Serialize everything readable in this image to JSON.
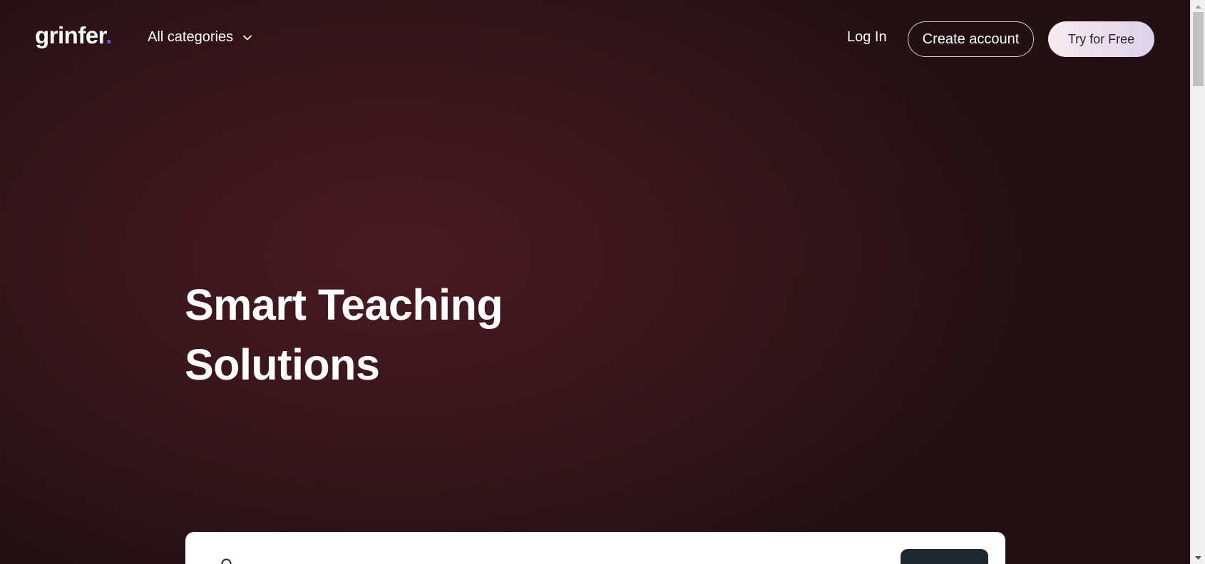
{
  "header": {
    "logo_text": "grinfer",
    "logo_dot": ".",
    "categories_label": "All categories",
    "login_label": "Log In",
    "create_account_label": "Create account",
    "try_free_label": "Try for Free"
  },
  "hero": {
    "title_line1": "Smart Teaching",
    "title_line2": "Solutions"
  },
  "icons": {
    "categories_chevron": "chevron-down-icon",
    "search": "search-icon",
    "scroll_up": "scroll-up-arrow-icon",
    "scroll_down": "scroll-down-arrow-icon"
  },
  "colors": {
    "background": "#3a161c",
    "logo_dot": "#6b4de6",
    "search_button": "#1e2830",
    "try_button": "#efe3ec"
  }
}
